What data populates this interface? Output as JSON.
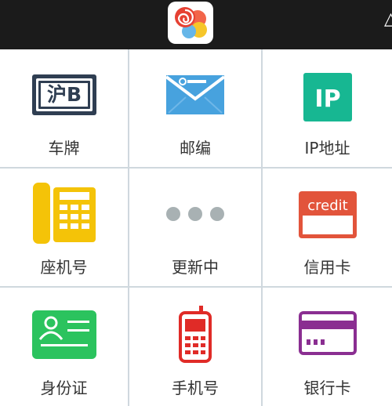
{
  "header": {
    "top_right_glyph": "△"
  },
  "tiles": [
    {
      "label": "车牌",
      "icon": "license-plate-icon",
      "icon_text": "沪B",
      "color": "#2f3e52"
    },
    {
      "label": "邮编",
      "icon": "envelope-icon",
      "color": "#47a2de"
    },
    {
      "label": "IP地址",
      "icon": "ip-icon",
      "icon_text": "IP",
      "color": "#17b792"
    },
    {
      "label": "座机号",
      "icon": "desk-phone-icon",
      "color": "#f4c308"
    },
    {
      "label": "更新中",
      "icon": "dots-icon",
      "color": "#a8b1b3"
    },
    {
      "label": "信用卡",
      "icon": "credit-card-icon",
      "icon_text": "credit",
      "color": "#e2543b"
    },
    {
      "label": "身份证",
      "icon": "id-card-icon",
      "color": "#2bc35e"
    },
    {
      "label": "手机号",
      "icon": "mobile-phone-icon",
      "color": "#e02b27"
    },
    {
      "label": "银行卡",
      "icon": "bank-card-icon",
      "color": "#8a2e91"
    }
  ]
}
